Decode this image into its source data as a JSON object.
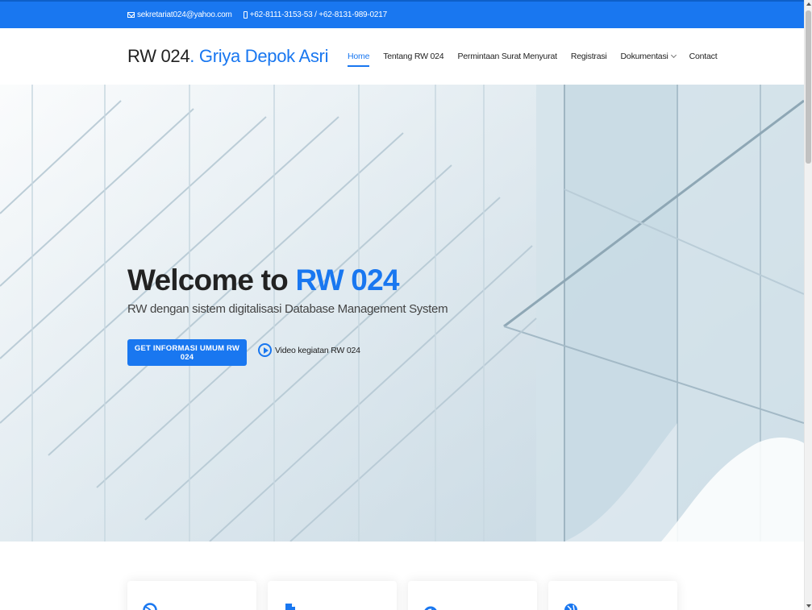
{
  "topbar": {
    "email": "sekretariat024@yahoo.com",
    "phone": "+62-8111-3153-53 / +62-8131-989-0217"
  },
  "header": {
    "logo_main": "RW 024",
    "logo_accent": ". Griya Depok Asri",
    "nav": [
      {
        "label": "Home",
        "active": true
      },
      {
        "label": "Tentang RW 024"
      },
      {
        "label": "Permintaan Surat Menyurat"
      },
      {
        "label": "Registrasi"
      },
      {
        "label": "Dokumentasi",
        "dropdown": true
      },
      {
        "label": "Contact"
      }
    ]
  },
  "hero": {
    "title_prefix": "Welcome to ",
    "title_accent": "RW 024",
    "subtitle": "RW dengan sistem digitalisasi Database Management System",
    "cta_label": "GET INFORMASI UMUM RW 024",
    "video_label": "Video kegiatan RW 024"
  },
  "cards": [
    {
      "icon": "dribbble-icon"
    },
    {
      "icon": "file-icon"
    },
    {
      "icon": "speedometer-icon"
    },
    {
      "icon": "globe-icon"
    }
  ],
  "colors": {
    "accent": "#1977f0",
    "text": "#222222"
  }
}
